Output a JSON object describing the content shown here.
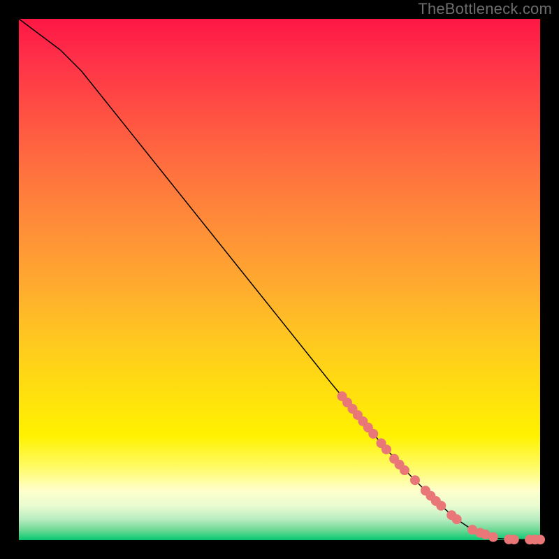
{
  "watermark": "TheBottleneck.com",
  "chart_data": {
    "type": "line",
    "title": "",
    "xlabel": "",
    "ylabel": "",
    "xlim": [
      0,
      100
    ],
    "ylim": [
      0,
      100
    ],
    "background_gradient": {
      "direction": "vertical",
      "stops": [
        {
          "pos": 0.0,
          "color": "#ff1744"
        },
        {
          "pos": 0.5,
          "color": "#ffad2e"
        },
        {
          "pos": 0.8,
          "color": "#fff200"
        },
        {
          "pos": 0.93,
          "color": "#e8fbd0"
        },
        {
          "pos": 1.0,
          "color": "#07c46f"
        }
      ]
    },
    "series": [
      {
        "name": "bottleneck-curve",
        "type": "line",
        "x": [
          0,
          4,
          8,
          12,
          20,
          30,
          40,
          50,
          60,
          65,
          70,
          75,
          80,
          84,
          87,
          90,
          92,
          94,
          96,
          98,
          100
        ],
        "y": [
          100,
          97,
          94,
          90,
          80,
          67.5,
          55,
          42.5,
          30,
          24,
          18,
          12.5,
          7.5,
          4,
          2,
          0.8,
          0.3,
          0.15,
          0.1,
          0.1,
          0.1
        ]
      },
      {
        "name": "sample-points",
        "type": "scatter",
        "color": "#e97777",
        "x": [
          62,
          63,
          64,
          65,
          66,
          67,
          68,
          69.5,
          70.5,
          72,
          73,
          74,
          76,
          78,
          79,
          80,
          81,
          83,
          84,
          87,
          88.5,
          89.5,
          91,
          94,
          95,
          98,
          99,
          100
        ],
        "y": [
          27.6,
          26.4,
          25.2,
          24,
          22.8,
          21.6,
          20.4,
          18.6,
          17.4,
          15.6,
          14.5,
          13.4,
          11.5,
          9.5,
          8.5,
          7.5,
          6.6,
          4.8,
          4.0,
          2.0,
          1.4,
          1.1,
          0.6,
          0.15,
          0.12,
          0.1,
          0.1,
          0.1
        ]
      }
    ]
  }
}
